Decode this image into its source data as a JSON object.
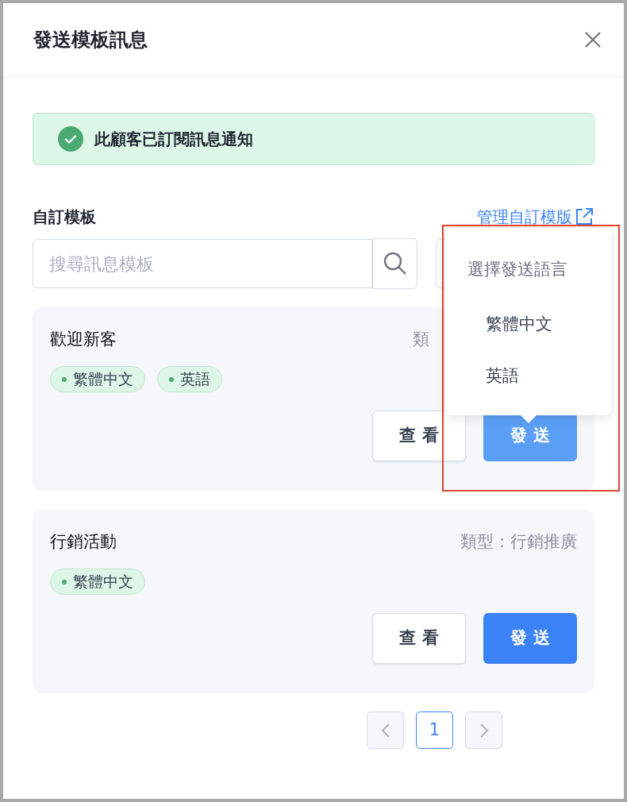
{
  "dialog": {
    "title": "發送模板訊息"
  },
  "alert": {
    "text": "此顧客已訂閱訊息通知"
  },
  "section": {
    "title": "自訂模板",
    "manage_link": "管理自訂模版"
  },
  "search": {
    "placeholder": "搜尋訊息模板"
  },
  "templates": [
    {
      "name": "歡迎新客",
      "type": "類",
      "languages": [
        "繁體中文",
        "英語"
      ],
      "view_label": "查 看",
      "send_label": "發 送",
      "send_active": true
    },
    {
      "name": "行銷活動",
      "type": "類型：行銷推廣",
      "languages": [
        "繁體中文"
      ],
      "view_label": "查 看",
      "send_label": "發 送",
      "send_active": false
    }
  ],
  "popup": {
    "title": "選擇發送語言",
    "options": [
      "繁體中文",
      "英語"
    ],
    "highlighted": true
  },
  "pagination": {
    "pages": [
      {
        "label": "1",
        "selected": true
      }
    ]
  }
}
